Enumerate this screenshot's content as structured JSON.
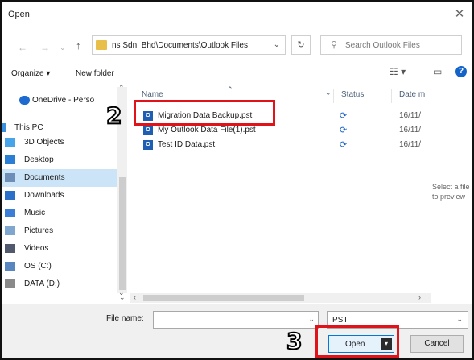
{
  "window": {
    "title": "Open",
    "close_symbol": "✕"
  },
  "address": {
    "path": "ns Sdn. Bhd\\Documents\\Outlook Files",
    "search_placeholder": "Search Outlook Files"
  },
  "toolbar": {
    "organize": "Organize ▾",
    "new_folder": "New folder"
  },
  "nav": {
    "items": [
      {
        "label": "OneDrive - Perso",
        "icon": "cloud-icon",
        "color": "#1d6bd1"
      },
      {
        "label": "This PC",
        "icon": "computer-icon",
        "color": "#3a8fde"
      },
      {
        "label": "3D Objects",
        "icon": "cube-icon",
        "color": "#47a4e8"
      },
      {
        "label": "Desktop",
        "icon": "desktop-icon",
        "color": "#2a7fd4"
      },
      {
        "label": "Documents",
        "icon": "document-icon",
        "color": "#6d8fb7",
        "selected": true
      },
      {
        "label": "Downloads",
        "icon": "download-icon",
        "color": "#2a70c9"
      },
      {
        "label": "Music",
        "icon": "music-icon",
        "color": "#3a7ed8"
      },
      {
        "label": "Pictures",
        "icon": "pictures-icon",
        "color": "#7fa6cf"
      },
      {
        "label": "Videos",
        "icon": "video-icon",
        "color": "#505a6c"
      },
      {
        "label": "OS (C:)",
        "icon": "drive-icon",
        "color": "#5a86c0"
      },
      {
        "label": "DATA (D:)",
        "icon": "drive-icon",
        "color": "#8a8a8a"
      }
    ]
  },
  "list": {
    "columns": {
      "name": "Name",
      "status": "Status",
      "date": "Date m"
    },
    "files": [
      {
        "name": "Migration Data Backup.pst",
        "status": "sync-icon",
        "date": "16/11/"
      },
      {
        "name": "My Outlook Data File(1).pst",
        "status": "sync-icon",
        "date": "16/11/"
      },
      {
        "name": "Test ID Data.pst",
        "status": "sync-icon",
        "date": "16/11/"
      }
    ]
  },
  "preview": {
    "line1": "Select a file",
    "line2": "to preview"
  },
  "bottom": {
    "file_name_label": "File name:",
    "file_name_value": "",
    "file_type": "PST",
    "open_label": "Open",
    "cancel_label": "Cancel"
  },
  "annotations": {
    "step2": "2",
    "step3": "3",
    "highlight_color": "#e0131a"
  }
}
